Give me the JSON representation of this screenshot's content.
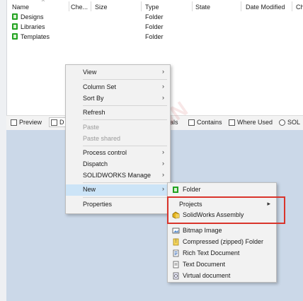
{
  "columns": [
    "Name",
    "Che...",
    "Size",
    "Type",
    "State",
    "Date Modified",
    "Ch"
  ],
  "rows": [
    {
      "name": "Designs",
      "type": "Folder"
    },
    {
      "name": "Libraries",
      "type": "Folder"
    },
    {
      "name": "Templates",
      "type": "Folder"
    }
  ],
  "tabs": [
    {
      "label": "Preview",
      "icon": "preview-icon"
    },
    {
      "label": "D",
      "icon": "data-card-icon"
    },
    {
      "label": "rials",
      "icon": "bill-of-materials-icon"
    },
    {
      "label": "Contains",
      "icon": "contains-icon"
    },
    {
      "label": "Where Used",
      "icon": "where-used-icon"
    },
    {
      "label": "SOL",
      "icon": "solidworks-icon"
    }
  ],
  "context_menu": [
    {
      "label": "View",
      "submenu": true,
      "disabled": false
    },
    {
      "separator": true
    },
    {
      "label": "Column Set",
      "submenu": true,
      "disabled": false
    },
    {
      "label": "Sort By",
      "submenu": true,
      "disabled": false
    },
    {
      "separator": true
    },
    {
      "label": "Refresh",
      "submenu": false,
      "disabled": false
    },
    {
      "separator": true
    },
    {
      "label": "Paste",
      "submenu": false,
      "disabled": true
    },
    {
      "label": "Paste shared",
      "submenu": false,
      "disabled": true
    },
    {
      "separator": true
    },
    {
      "label": "Process control",
      "submenu": true,
      "disabled": false
    },
    {
      "label": "Dispatch",
      "submenu": true,
      "disabled": false
    },
    {
      "label": "SOLIDWORKS Manage",
      "submenu": true,
      "disabled": false
    },
    {
      "separator": true
    },
    {
      "label": "New",
      "submenu": true,
      "disabled": false,
      "highlighted": true
    },
    {
      "separator": true
    },
    {
      "label": "Properties",
      "submenu": false,
      "disabled": false
    }
  ],
  "new_submenu": [
    {
      "label": "Folder",
      "icon": "folder-icon"
    },
    {
      "separator": true
    },
    {
      "label": "Projects",
      "icon": "",
      "submenu": true
    },
    {
      "label": "SolidWorks Assembly",
      "icon": "assembly-icon"
    },
    {
      "separator": true
    },
    {
      "label": "Bitmap Image",
      "icon": "bitmap-icon"
    },
    {
      "label": "Compressed (zipped) Folder",
      "icon": "zip-folder-icon"
    },
    {
      "label": "Rich Text Document",
      "icon": "rtf-icon"
    },
    {
      "label": "Text Document",
      "icon": "text-doc-icon"
    },
    {
      "label": "Virtual document",
      "icon": "virtual-doc-icon"
    }
  ],
  "colors": {
    "highlight": "#cce4f7",
    "annotation_box": "#d9342b",
    "folder_green": "#23a223",
    "pane_blue": "#cbd8e8"
  }
}
